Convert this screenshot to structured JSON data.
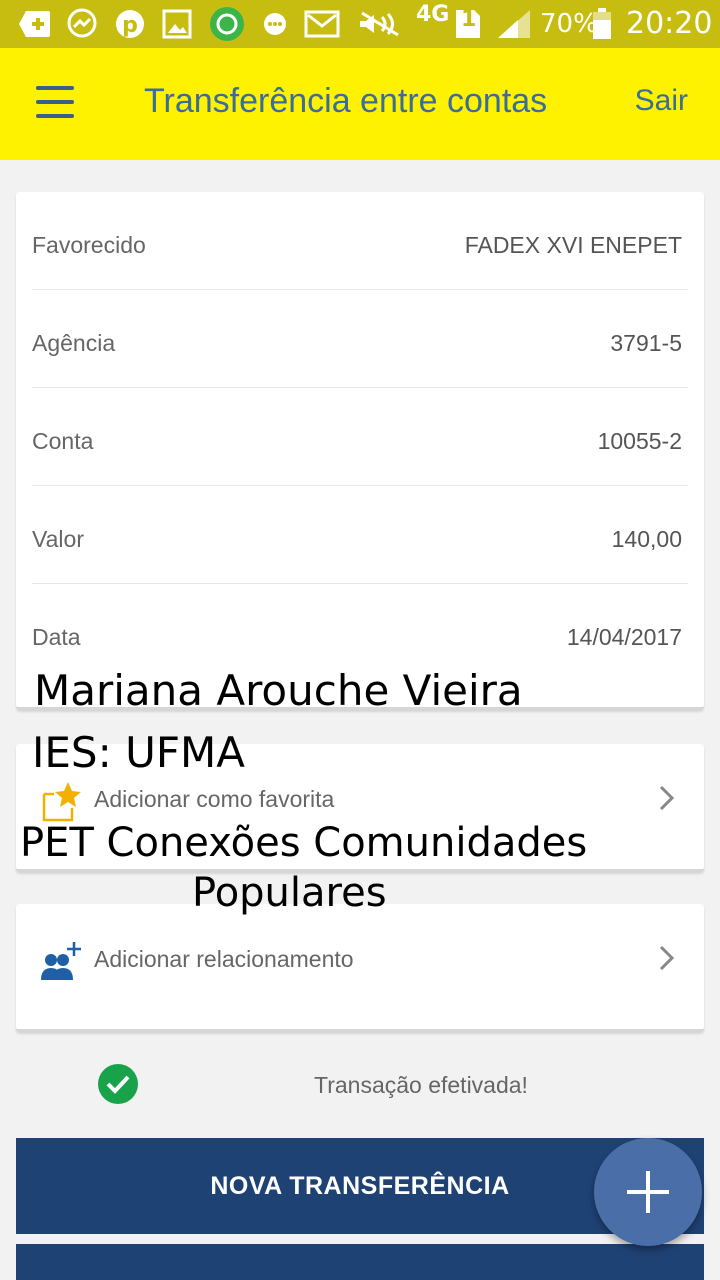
{
  "status_bar": {
    "signal": "4G",
    "sim": "1",
    "battery": "70%",
    "time": "20:20"
  },
  "app_bar": {
    "title": "Transferência entre contas",
    "logout_label": "Sair"
  },
  "details": [
    {
      "label": "Favorecido",
      "value": "FADEX XVI ENEPET"
    },
    {
      "label": "Agência",
      "value": "3791-5"
    },
    {
      "label": "Conta",
      "value": "10055-2"
    },
    {
      "label": "Valor",
      "value": "140,00"
    },
    {
      "label": "Data",
      "value": "14/04/2017"
    }
  ],
  "actions": {
    "favorite_label": "Adicionar como favorita",
    "relationship_label": "Adicionar relacionamento"
  },
  "status_message": "Transação efetivada!",
  "buttons": {
    "new_transfer": "NOVA TRANSFERÊNCIA"
  },
  "overlay": {
    "line1": "Mariana Arouche Vieira",
    "line2": "IES: UFMA",
    "line3": "PET Conexões Comunidades",
    "line4": "Populares"
  },
  "colors": {
    "app_bar": "#fff200",
    "status_bar": "#c7bd10",
    "primary_button": "#1f4275",
    "fab": "#4a6fa8",
    "success": "#18a34a"
  }
}
